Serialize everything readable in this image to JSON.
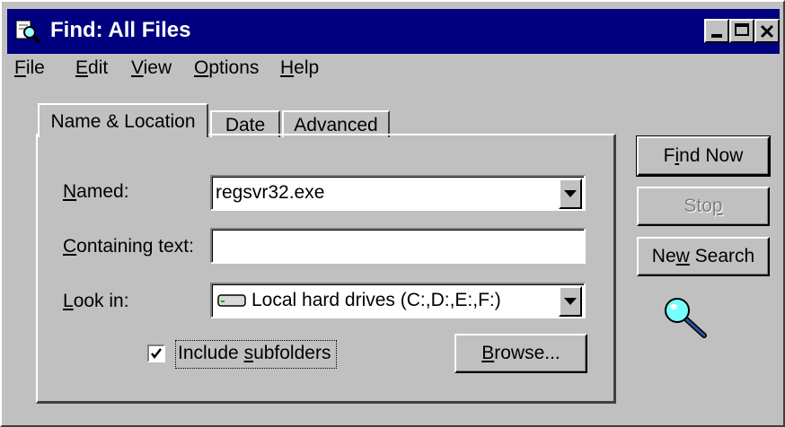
{
  "window": {
    "title": "Find: All Files"
  },
  "menu": {
    "file": {
      "hot": "F",
      "rest": "ile"
    },
    "edit": {
      "hot": "E",
      "rest": "dit"
    },
    "view": {
      "hot": "V",
      "rest": "iew"
    },
    "options": {
      "hot": "O",
      "rest": "ptions"
    },
    "help": {
      "hot": "H",
      "rest": "elp"
    }
  },
  "tabs": {
    "name_location": "Name & Location",
    "date": "Date",
    "advanced": "Advanced"
  },
  "form": {
    "named": {
      "hot": "N",
      "rest": "amed:",
      "value": "regsvr32.exe"
    },
    "containing": {
      "hot": "C",
      "rest": "ontaining text:",
      "value": ""
    },
    "look_in": {
      "hot": "L",
      "rest": "ook in:",
      "value": "Local hard drives (C:,D:,E:,F:)"
    },
    "subfolders": {
      "hot": "s",
      "pre": "Include ",
      "rest": "ubfolders",
      "checked": true
    },
    "browse": {
      "hot": "B",
      "rest": "rowse..."
    }
  },
  "buttons": {
    "find_now": {
      "hot": "i",
      "pre": "F",
      "rest": "nd Now"
    },
    "stop": {
      "hot": "p",
      "pre": "Sto",
      "rest": ""
    },
    "new_search": {
      "hot": "w",
      "pre": "Ne",
      "rest": " Search"
    }
  },
  "icons": {
    "app": "find-icon",
    "search": "magnifier-icon",
    "drive": "hard-drive-icon"
  }
}
